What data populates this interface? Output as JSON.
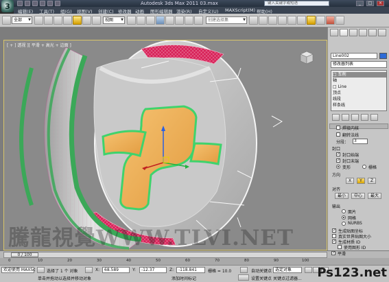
{
  "window": {
    "title": "Autodesk 3ds Max  2011    03.max",
    "help_search_placeholder": "键入关键字或短语"
  },
  "menu": [
    "编辑(E)",
    "工具(T)",
    "组(G)",
    "视图(V)",
    "创建(C)",
    "修改器",
    "动画",
    "图形编辑器",
    "渲染(R)",
    "自定义(U)",
    "MAXScript(M)",
    "帮助(H)"
  ],
  "toolbar": {
    "selection_filter": "全部",
    "reference_coord": "视图",
    "named_selection_placeholder": "创建选择集"
  },
  "viewport": {
    "label": "[ + ] 透视 ][ 平滑 + 高光 + 边面 ]",
    "viewcube_label": "上"
  },
  "command_panel": {
    "object_name": "Line002",
    "modifier_list": "修改器列表",
    "stack": [
      "□ 车削",
      "   轴",
      "□ Line",
      "     顶点",
      "     线段",
      "     样条线"
    ],
    "params": {
      "weld_core": "焊接内核",
      "flip_normals": "翻转法线",
      "segments_label": "分段：",
      "segments_value": "3",
      "capping_header": "封口",
      "cap_start": "封口始端",
      "cap_end": "封口末端",
      "morph": "变形",
      "grid": "栅格",
      "direction_header": "方向",
      "x": "X",
      "y": "Y",
      "z": "Z",
      "align_header": "对齐",
      "min": "最小",
      "center": "中心",
      "max": "最大",
      "output_header": "输出",
      "patch": "面片",
      "mesh": "网格",
      "nurbs": "NURBS",
      "gen_map_coords": "生成贴图坐标",
      "real_world_map": "真实世界贴图大小",
      "gen_mat_ids": "生成材质 ID",
      "use_shape_ids": "使用图形 ID",
      "smooth": "平滑"
    }
  },
  "timeline": {
    "frame_display": "0 / 100",
    "ruler_ticks": [
      "0",
      "10",
      "20",
      "30",
      "40",
      "50",
      "60",
      "70",
      "80",
      "90",
      "100"
    ]
  },
  "status": {
    "welcome": "欢迎使用 MAXSc",
    "selected": "选择了 1 个 对象",
    "prompt": "单击并拖动以选择并移动对象",
    "x_label": "X:",
    "x_value": "68.589",
    "y_label": "Y:",
    "y_value": "-12.37",
    "z_label": "Z:",
    "z_value": "-118.841",
    "grid": "栅格 = 10.0",
    "add_time_tag": "添加时间标记",
    "auto_key": "自动关键点",
    "set_key": "设置关键点",
    "selected_obj": "选定对象",
    "key_filters": "关键点过滤器..."
  },
  "watermark": "騰龍視覺WWW.TLVI.NET",
  "site_logo": "Ps123.net",
  "colors": {
    "viewport_bg": "#8a8a8a",
    "ring_red": "#d8245a",
    "shape_orange": "#f2b25a",
    "highlight_green": "#4fd26a",
    "title_bar": "#2f3a48"
  }
}
